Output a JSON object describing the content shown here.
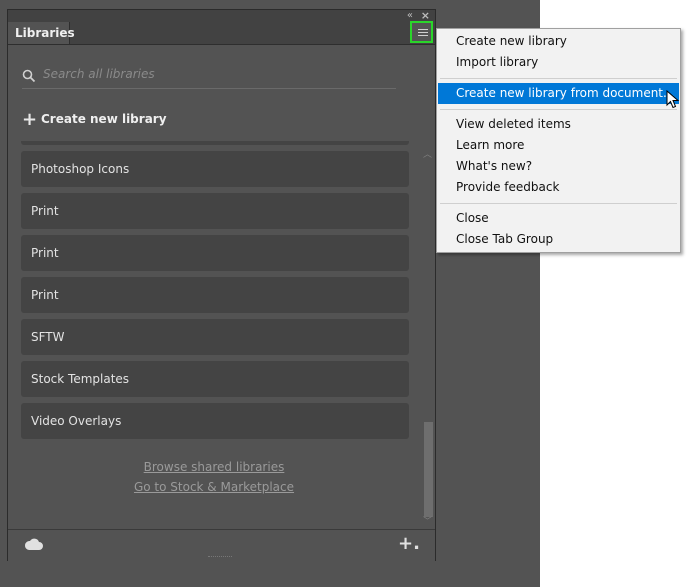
{
  "panel": {
    "tab_label": "Libraries",
    "collapse_glyph": "«",
    "close_glyph": "×",
    "search_placeholder": "Search all libraries",
    "create_label": "Create new library",
    "libraries": [
      "Photoshop Icons",
      "Print",
      "Print",
      "Print",
      "SFTW",
      "Stock Templates",
      "Video Overlays"
    ],
    "links": {
      "browse": "Browse shared libraries",
      "stock": "Go to Stock & Marketplace"
    },
    "footer": {
      "cloud_icon": "cloud-icon",
      "add_glyph": "+."
    }
  },
  "menu": {
    "create_new_library": "Create new library",
    "import_library": "Import library",
    "create_from_document": "Create new library from document...",
    "view_deleted": "View deleted items",
    "learn_more": "Learn more",
    "whats_new": "What's new?",
    "provide_feedback": "Provide feedback",
    "close": "Close",
    "close_tab_group": "Close Tab Group"
  },
  "colors": {
    "highlight": "#0078d7",
    "menu_button_outline": "#2ad52a",
    "panel_bg": "#535353"
  }
}
